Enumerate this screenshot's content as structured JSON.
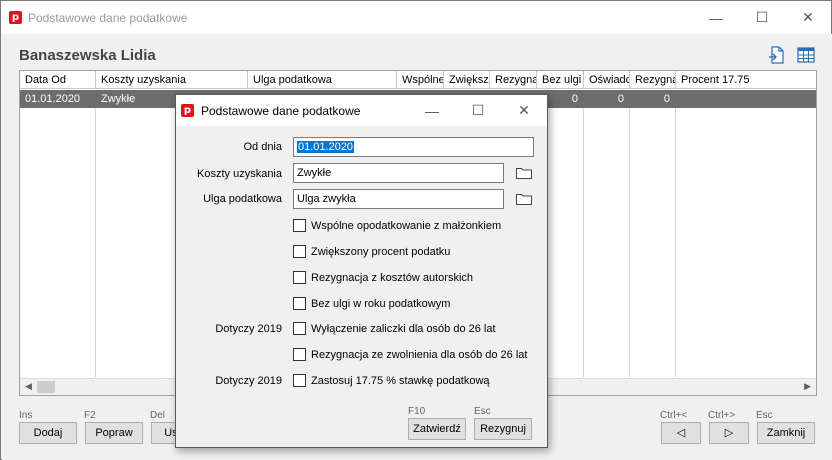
{
  "window": {
    "title": "Podstawowe dane podatkowe",
    "controls": {
      "minimize": "—",
      "maximize": "☐",
      "close": "✕"
    }
  },
  "main": {
    "person_name": "Banaszewska Lidia",
    "grid": {
      "columns": [
        "Data Od",
        "Koszty uzyskania",
        "Ulga podatkowa",
        "Wspólne",
        "Zwiększ",
        "Rezygna",
        "Bez ulgi",
        "Oświadc",
        "Rezygna",
        "Procent 17.75"
      ],
      "row": {
        "date": "01.01.2020",
        "costs": "Zwykłe",
        "v1": "0",
        "v2": "0",
        "v3": "0"
      }
    }
  },
  "bottom_bar": {
    "hotkeys": {
      "add": "Ins",
      "edit": "F2",
      "delete": "Del",
      "prev": "Ctrl+<",
      "next": "Ctrl+>",
      "close": "Esc"
    },
    "buttons": {
      "add": "Dodaj",
      "edit": "Popraw",
      "delete": "Us",
      "prev": "◁",
      "next": "▷",
      "close": "Zamknij"
    }
  },
  "dialog": {
    "title": "Podstawowe dane podatkowe",
    "labels": {
      "from_date": "Od dnia",
      "costs": "Koszty uzyskania",
      "tax_relief": "Ulga podatkowa"
    },
    "values": {
      "from_date": "01.01.2020",
      "costs": "Zwykłe",
      "tax_relief": "Ulga zwykła"
    },
    "checkboxes": [
      {
        "label": "Wspólne opodatkowanie z małżonkiem",
        "checked": false
      },
      {
        "label": "Zwiększony procent podatku",
        "checked": false
      },
      {
        "label": "Rezygnacja z kosztów autorskich",
        "checked": false
      },
      {
        "label": "Bez ulgi w roku podatkowym",
        "checked": false
      },
      {
        "label": "Wyłączenie zaliczki dla osób do 26 lat",
        "checked": false,
        "note": "Dotyczy 2019"
      },
      {
        "label": "Rezygnacja ze zwolnienia dla osób do 26 lat",
        "checked": false
      },
      {
        "label": "Zastosuj 17.75 % stawkę podatkową",
        "checked": false,
        "note": "Dotyczy 2019"
      }
    ],
    "hotkeys": {
      "confirm": "F10",
      "cancel": "Esc"
    },
    "buttons": {
      "confirm": "Zatwierdź",
      "cancel": "Rezygnuj"
    }
  },
  "colors": {
    "accent": "#e1141b",
    "selection": "#0078d7",
    "selected_row": "#6d6d6d"
  }
}
